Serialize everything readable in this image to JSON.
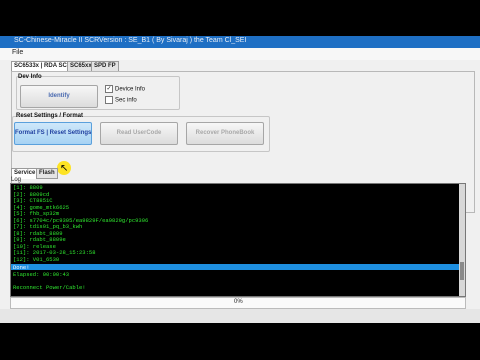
{
  "window": {
    "title": "SC-Chinese-Miracle II SCRVersion : SE_B1 ( By Sivaraj ) the Team Cl_SEI"
  },
  "menu": {
    "file": "File"
  },
  "tabs": [
    "SC6533x | RDA SC",
    "SC65xx",
    "SPD FP"
  ],
  "dev_info": {
    "title": "Dev Info",
    "identify": "Identify",
    "device_info": "Device Info",
    "sec_info": "Sec info",
    "device_info_checked": true,
    "sec_info_checked": false
  },
  "reset": {
    "title": "Reset Settings / Format",
    "format_reset": "Format FS | Reset Settings",
    "read_usercode": "Read UserCode",
    "recover_phonebook": "Recover PhoneBook"
  },
  "bottom_tabs": [
    "Service",
    "Flash"
  ],
  "log": {
    "label": "Log",
    "lines": [
      "[1]: 8809",
      "[2]: 8809cd",
      "[3]: CT8851C",
      "[4]: gome_mtk6625",
      "[5]: fhb_sp32m",
      "[6]: s7704c/pc9305/ea9829F/ea9829g/pc9306",
      "[7]: td1s01_pq_b3_kwh",
      "[8]: rdabt_8809",
      "[9]: rdabt_8809e",
      "[10]: release",
      "[11]: 2017-03-28_15:23:58",
      "[12]: V01_6530",
      "Done!",
      "Elapsed: 00:00:43",
      "",
      "Reconnect Power/Cable!"
    ],
    "selected_line": "Done!"
  },
  "status": {
    "progress": "0%"
  }
}
